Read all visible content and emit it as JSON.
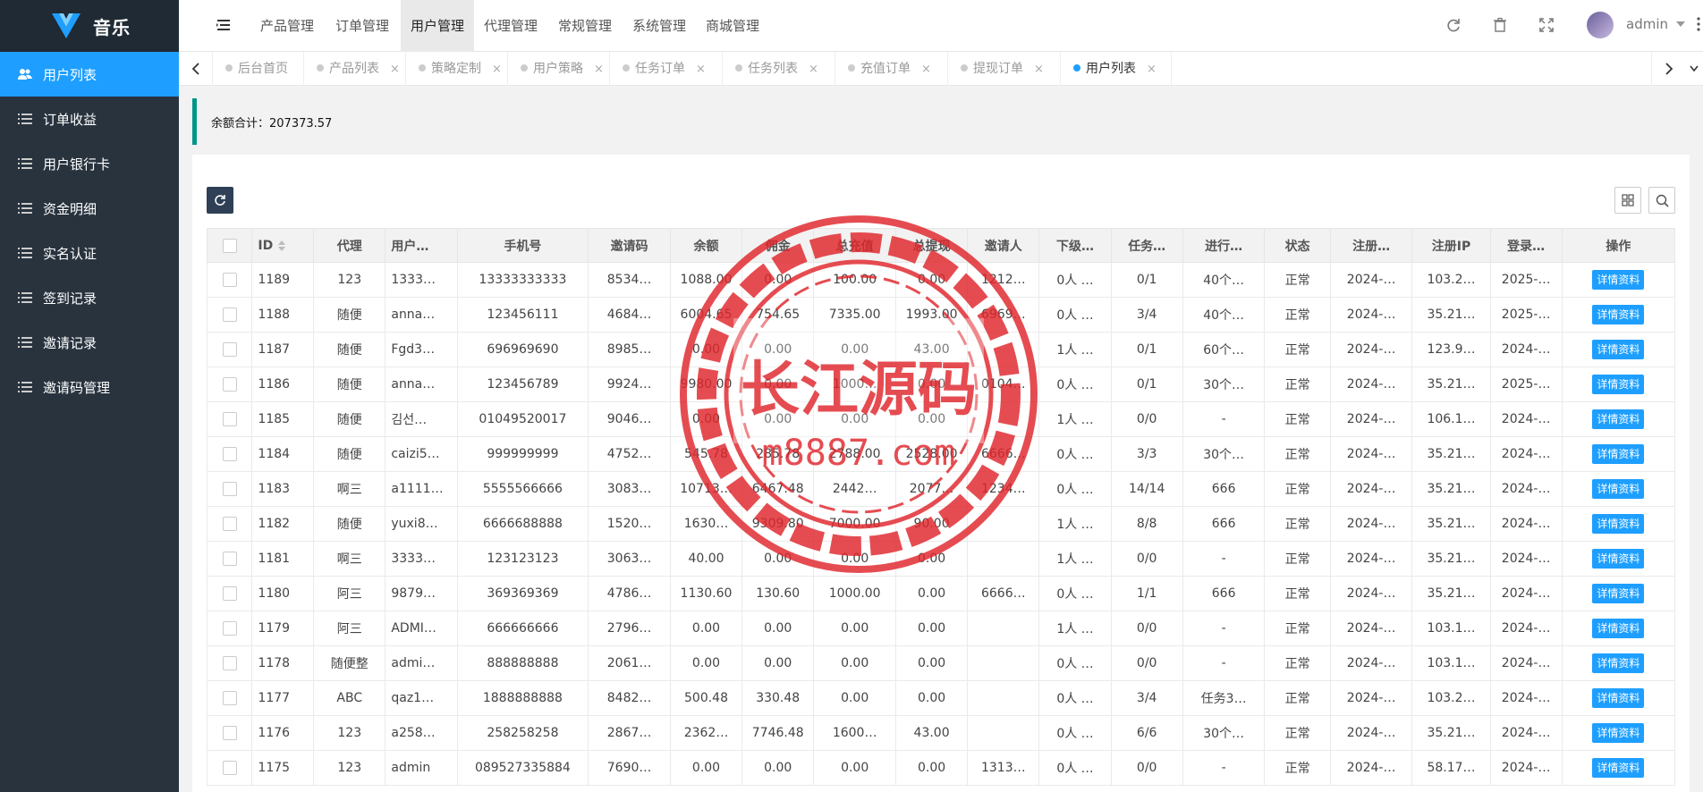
{
  "app": {
    "title": "音乐"
  },
  "sidebar": {
    "items": [
      {
        "label": "用户列表",
        "active": true
      },
      {
        "label": "订单收益"
      },
      {
        "label": "用户银行卡"
      },
      {
        "label": "资金明细"
      },
      {
        "label": "实名认证"
      },
      {
        "label": "签到记录"
      },
      {
        "label": "邀请记录"
      },
      {
        "label": "邀请码管理"
      }
    ]
  },
  "header": {
    "nav": [
      {
        "label": "产品管理"
      },
      {
        "label": "订单管理"
      },
      {
        "label": "用户管理",
        "active": true
      },
      {
        "label": "代理管理"
      },
      {
        "label": "常规管理"
      },
      {
        "label": "系统管理"
      },
      {
        "label": "商城管理"
      }
    ],
    "user": "admin"
  },
  "tabs": [
    {
      "label": "后台首页",
      "closable": false
    },
    {
      "label": "产品列表",
      "closable": true
    },
    {
      "label": "策略定制",
      "closable": true
    },
    {
      "label": "用户策略",
      "closable": true
    },
    {
      "label": "任务订单",
      "closable": true
    },
    {
      "label": "任务列表",
      "closable": true
    },
    {
      "label": "充值订单",
      "closable": true
    },
    {
      "label": "提现订单",
      "closable": true
    },
    {
      "label": "用户列表",
      "closable": true,
      "active": true
    }
  ],
  "tab_close_glyph": "×",
  "balance": {
    "text": "余额合计：207373.57"
  },
  "table": {
    "columns": [
      "ID",
      "代理",
      "用户…",
      "手机号",
      "邀请码",
      "余额",
      "佣金",
      "总充值",
      "总提现",
      "邀请人",
      "下级…",
      "任务…",
      "进行…",
      "状态",
      "注册…",
      "注册IP",
      "登录…",
      "操作"
    ],
    "action_label": "详情资料",
    "rows": [
      [
        "1189",
        "123",
        "1333…",
        "13333333333",
        "8534…",
        "1088.00",
        "0.00",
        "100.00",
        "0.00",
        "1212…",
        "0人 …",
        "0/1",
        "40个…",
        "正常",
        "2024-…",
        "103.2…",
        "2025-…"
      ],
      [
        "1188",
        "随便",
        "anna…",
        "123456111",
        "4684…",
        "6004.65",
        "754.65",
        "7335.00",
        "1993.00",
        "6969…",
        "0人 …",
        "3/4",
        "40个…",
        "正常",
        "2024-…",
        "35.21…",
        "2025-…"
      ],
      [
        "1187",
        "随便",
        "Fgd3…",
        "696969690",
        "8985…",
        "0.00",
        "0.00",
        "0.00",
        "43.00",
        "",
        "1人 …",
        "0/1",
        "60个…",
        "正常",
        "2024-…",
        "123.9…",
        "2024-…"
      ],
      [
        "1186",
        "随便",
        "anna…",
        "123456789",
        "9924…",
        "9980.00",
        "0.00",
        "1000…",
        "0.00",
        "0104…",
        "0人 …",
        "0/1",
        "30个…",
        "正常",
        "2024-…",
        "35.21…",
        "2025-…"
      ],
      [
        "1185",
        "随便",
        "김선…",
        "01049520017",
        "9046…",
        "0.00",
        "0.00",
        "0.00",
        "0.00",
        "",
        "1人 …",
        "0/0",
        "-",
        "正常",
        "2024-…",
        "106.1…",
        "2024-…"
      ],
      [
        "1184",
        "随便",
        "caizi5…",
        "999999999",
        "4752…",
        "545.78",
        "285.78",
        "2788.00",
        "2528.00",
        "6666…",
        "0人 …",
        "3/3",
        "30个…",
        "正常",
        "2024-…",
        "35.21…",
        "2024-…"
      ],
      [
        "1183",
        "啊三",
        "a1111…",
        "5555566666",
        "3083…",
        "10713…",
        "6467.48",
        "2442…",
        "2077…",
        "1234…",
        "0人 …",
        "14/14",
        "666",
        "正常",
        "2024-…",
        "35.21…",
        "2024-…"
      ],
      [
        "1182",
        "随便",
        "yuxi8…",
        "6666688888",
        "1520…",
        "1630…",
        "9309.80",
        "7000.00",
        "90.00",
        "",
        "1人 …",
        "8/8",
        "666",
        "正常",
        "2024-…",
        "35.21…",
        "2024-…"
      ],
      [
        "1181",
        "啊三",
        "3333…",
        "123123123",
        "3063…",
        "40.00",
        "0.00",
        "0.00",
        "0.00",
        "",
        "1人 …",
        "0/0",
        "-",
        "正常",
        "2024-…",
        "35.21…",
        "2024-…"
      ],
      [
        "1180",
        "阿三",
        "9879…",
        "369369369",
        "4786…",
        "1130.60",
        "130.60",
        "1000.00",
        "0.00",
        "6666…",
        "0人 …",
        "1/1",
        "666",
        "正常",
        "2024-…",
        "35.21…",
        "2024-…"
      ],
      [
        "1179",
        "阿三",
        "ADMI…",
        "666666666",
        "2796…",
        "0.00",
        "0.00",
        "0.00",
        "0.00",
        "",
        "1人 …",
        "0/0",
        "-",
        "正常",
        "2024-…",
        "103.1…",
        "2024-…"
      ],
      [
        "1178",
        "随便整",
        "admi…",
        "888888888",
        "2061…",
        "0.00",
        "0.00",
        "0.00",
        "0.00",
        "",
        "0人 …",
        "0/0",
        "-",
        "正常",
        "2024-…",
        "103.1…",
        "2024-…"
      ],
      [
        "1177",
        "ABC",
        "qaz1…",
        "1888888888",
        "8482…",
        "500.48",
        "330.48",
        "0.00",
        "0.00",
        "",
        "0人 …",
        "3/4",
        "任务3…",
        "正常",
        "2024-…",
        "103.2…",
        "2024-…"
      ],
      [
        "1176",
        "123",
        "a258…",
        "258258258",
        "2867…",
        "2362…",
        "7746.48",
        "1600…",
        "43.00",
        "",
        "0人 …",
        "6/6",
        "30个…",
        "正常",
        "2024-…",
        "35.21…",
        "2024-…"
      ],
      [
        "1175",
        "123",
        "admin",
        "089527335884",
        "7690…",
        "0.00",
        "0.00",
        "0.00",
        "0.00",
        "1313…",
        "0人 …",
        "0/0",
        "-",
        "正常",
        "2024-…",
        "58.17…",
        "2024-…"
      ]
    ]
  },
  "watermark": {
    "line1": "长江源码",
    "line2": "m8887.com"
  },
  "colors": {
    "sidebar": "#28333e",
    "accent": "#1e9fff",
    "balance_border": "#009688",
    "stamp": "#e0262b"
  }
}
